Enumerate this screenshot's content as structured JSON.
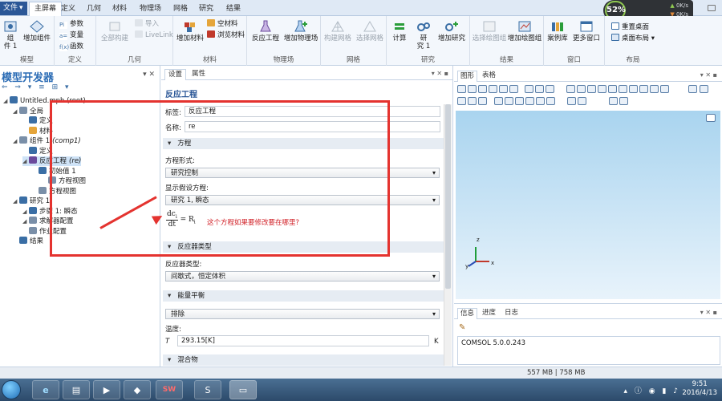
{
  "ribbon_tabs": [
    "文件",
    "主屏幕",
    "定义",
    "几何",
    "材料",
    "物理场",
    "网格",
    "研究",
    "结果"
  ],
  "ribbon": {
    "groups": {
      "model": "模型",
      "definitions": "定义",
      "geometry": "几何",
      "materials": "材料",
      "physics": "物理场",
      "mesh": "网格",
      "study": "研究",
      "results": "结果",
      "window": "窗口",
      "layout": "布局"
    },
    "buttons": {
      "component": "组\n件 1",
      "add_component": "增加组件",
      "parameters": "参数",
      "variables": "变量",
      "functions": "函数",
      "build_all": "全部构建",
      "import": "导入",
      "livelink": "LiveLink",
      "add_material": "增加材料",
      "blank_material": "空材料",
      "browse_materials": "浏览材料",
      "reaction_engineering": "反应工程",
      "add_physics": "增加物理场",
      "build_mesh": "构建网格",
      "select_mesh": "选择网格",
      "compute": "计算",
      "study1": "研\n究 1",
      "add_study": "增加研究",
      "select_plot_group": "选择绘图组",
      "add_plot_group": "增加绘图组",
      "examples": "案例库",
      "more_windows": "更多窗口",
      "reset_desktop": "重置桌面",
      "desktop_layout": "桌面布局"
    }
  },
  "speed_widget": {
    "percent": "52%",
    "up": "0K/s",
    "down": "0K/s"
  },
  "model_builder": {
    "title": "模型开发器",
    "tree": [
      {
        "label": "Untitled.mph (root)",
        "level": 0
      },
      {
        "label": "全局",
        "level": 1
      },
      {
        "label": "定义",
        "level": 2
      },
      {
        "label": "材料",
        "level": 2
      },
      {
        "label": "组件 1",
        "suffix": "(comp1)",
        "level": 1
      },
      {
        "label": "定义",
        "level": 2
      },
      {
        "label": "反应工程",
        "suffix": "(re)",
        "level": 2,
        "selected": true
      },
      {
        "label": "初始值 1",
        "level": 3
      },
      {
        "label": "方程视图",
        "level": 4
      },
      {
        "label": "方程视图",
        "level": 3
      },
      {
        "label": "研究 1",
        "level": 1
      },
      {
        "label": "步骤 1: 瞬态",
        "level": 2
      },
      {
        "label": "求解器配置",
        "level": 2
      },
      {
        "label": "作业配置",
        "level": 2
      },
      {
        "label": "结果",
        "level": 1
      }
    ]
  },
  "settings": {
    "tabs": [
      "设置",
      "属性"
    ],
    "title": "反应工程",
    "label_caption": "标签:",
    "label_value": "反应工程",
    "name_caption": "名称:",
    "name_value": "re",
    "sections": {
      "equation": "方程",
      "reactor_type": "反应器类型",
      "energy_balance": "能量平衡",
      "mixture": "混合物"
    },
    "equation_form_caption": "方程形式:",
    "equation_form_value": "研究控制",
    "show_equation_caption": "显示假设方程:",
    "show_equation_value": "研究 1, 瞬态",
    "equation": {
      "num": "dc",
      "num_sub": "i",
      "den": "dt",
      "rhs": "= R",
      "rhs_sub": "i"
    },
    "question": "这个方程如果要修改要在哪里?",
    "reactor_type_caption": "反应器类型:",
    "reactor_type_value": "间歇式，恒定体积",
    "energy_value": "排除",
    "temperature_caption": "温度:",
    "temperature_symbol": "T",
    "temperature_value": "293.15[K]",
    "temperature_unit": "K"
  },
  "graphics": {
    "tabs": [
      "图形",
      "表格"
    ],
    "axes": {
      "x": "x",
      "y": "y",
      "z": "z"
    }
  },
  "info": {
    "tabs": [
      "信息",
      "进度",
      "日志"
    ],
    "text": "COMSOL 5.0.0.243"
  },
  "status_bar": {
    "memory": "557 MB | 758 MB"
  },
  "taskbar": {
    "time": "9:51",
    "date": "2016/4/13",
    "apps": [
      "ie",
      "explorer",
      "media-player",
      "browser",
      "solidworks",
      "sogou",
      "comsol"
    ]
  },
  "colors": {
    "annotation": "#e4332f",
    "accent": "#2b5797"
  }
}
